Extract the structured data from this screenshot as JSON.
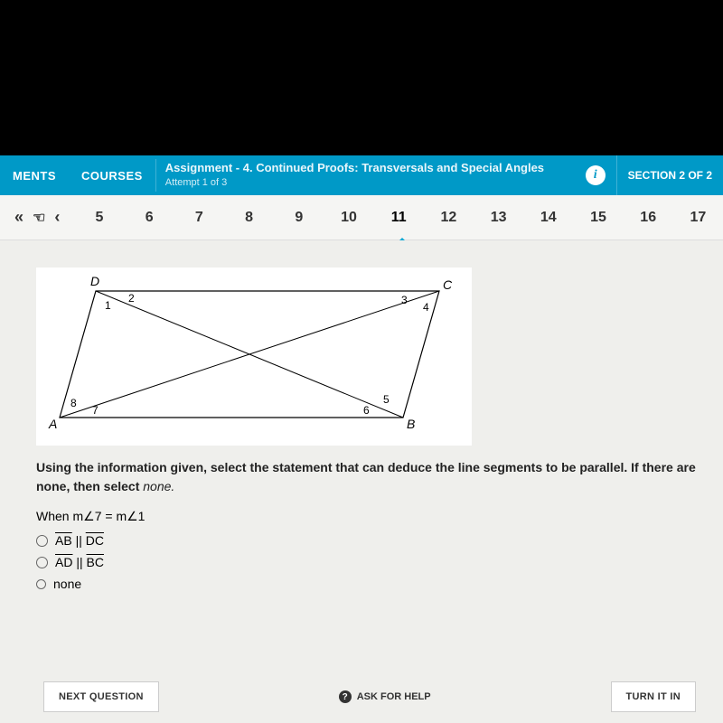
{
  "nav": {
    "left1": "MENTS",
    "left2": "COURSES"
  },
  "assignment": {
    "title": "Assignment  - 4. Continued Proofs: Transversals and Special Angles",
    "attempt": "Attempt 1 of 3"
  },
  "section": "SECTION 2 OF 2",
  "qnav": {
    "numbers": [
      "5",
      "6",
      "7",
      "8",
      "9",
      "10",
      "11",
      "12",
      "13",
      "14",
      "15",
      "16",
      "17"
    ],
    "activeIndex": 6
  },
  "diagram": {
    "labels": {
      "D": "D",
      "C": "C",
      "A": "A",
      "B": "B"
    },
    "angles": {
      "1": "1",
      "2": "2",
      "3": "3",
      "4": "4",
      "5": "5",
      "6": "6",
      "7": "7",
      "8": "8"
    }
  },
  "question": {
    "prompt": "Using the information given, select the statement that can deduce the line segments to be parallel. If there are none, then select ",
    "prompt_italic": "none.",
    "given_prefix": "When m",
    "given_a": "7",
    "given_eq": " = m",
    "given_b": "1"
  },
  "options": {
    "o1_a": "AB",
    "o1_sep": " || ",
    "o1_b": "DC",
    "o2_a": "AD",
    "o2_sep": " || ",
    "o2_b": "BC",
    "o3": "none"
  },
  "buttons": {
    "next": "NEXT QUESTION",
    "ask": "ASK FOR HELP",
    "turnin": "TURN IT IN"
  }
}
